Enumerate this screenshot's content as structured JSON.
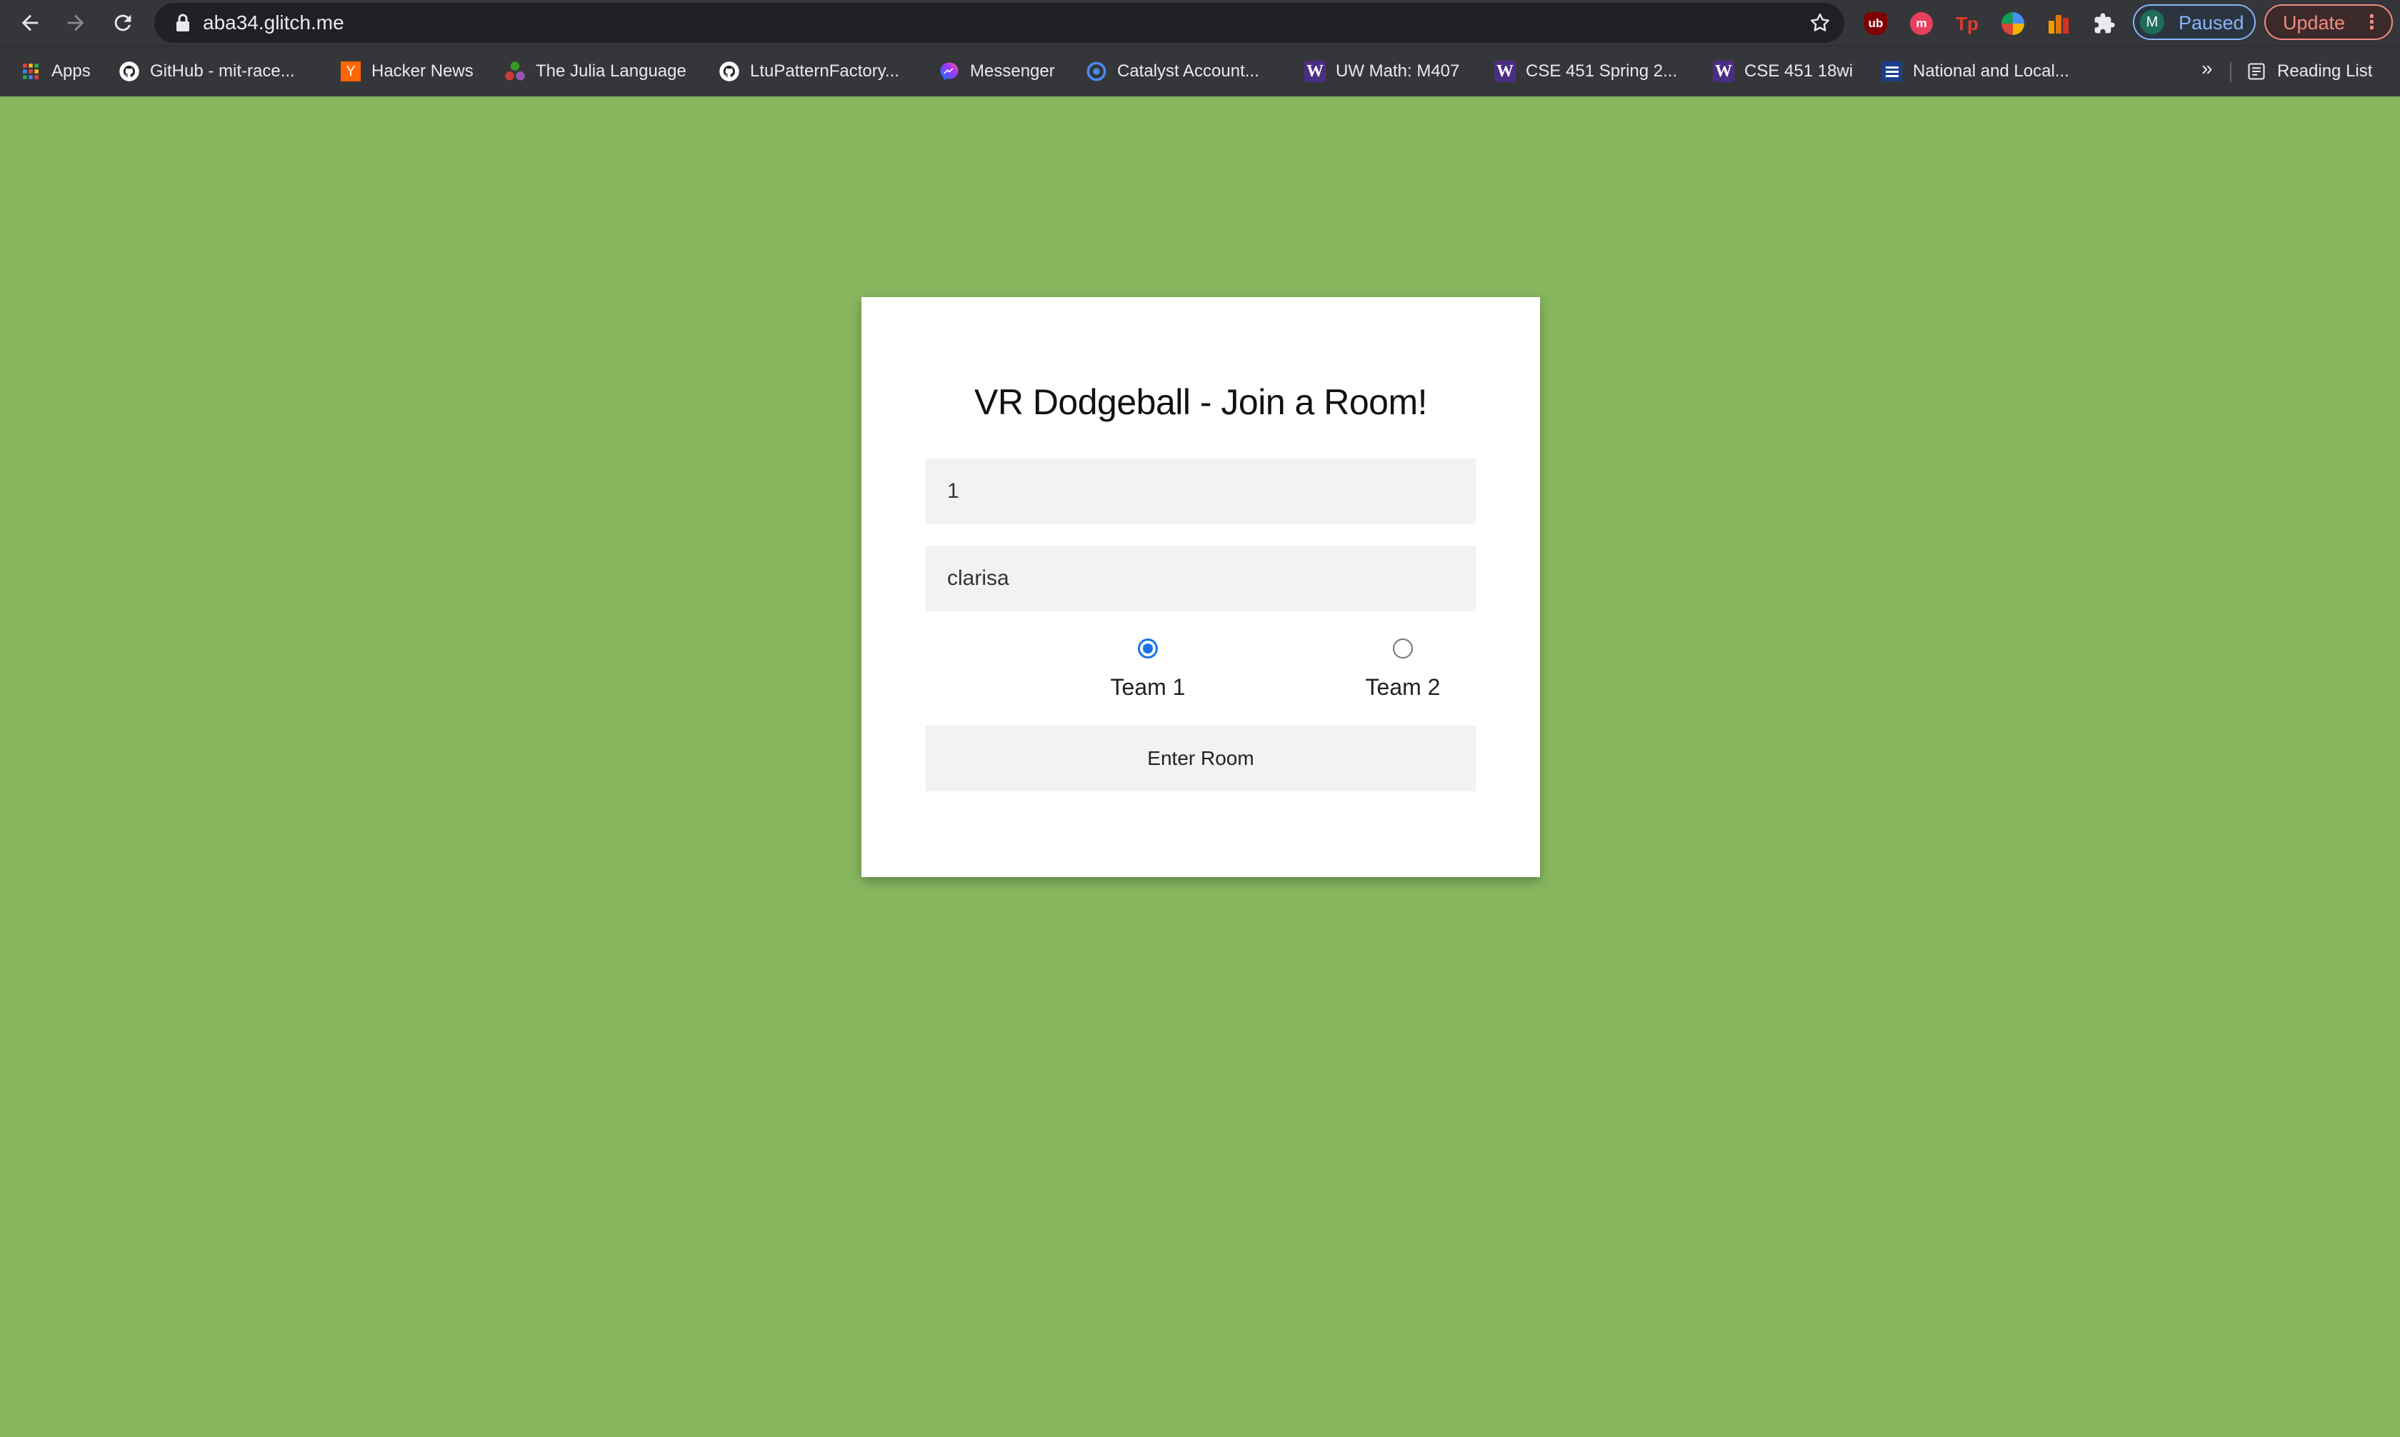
{
  "browser": {
    "url": "aba34.glitch.me",
    "profile": {
      "initial": "M",
      "label": "Paused"
    },
    "update_label": "Update",
    "extensions": [
      {
        "name": "ublock-icon",
        "text": "ub",
        "color": "#800000"
      },
      {
        "name": "mastodon-icon",
        "text": "m",
        "color": "#e5405c"
      },
      {
        "name": "tampermonkey-icon",
        "text": "Tp",
        "color": "#e33b2e"
      },
      {
        "name": "multicolor-extension-icon",
        "text": "",
        "color": "#4a8cf7"
      },
      {
        "name": "bar-chart-extension-icon",
        "text": "",
        "color": "#f29900"
      }
    ]
  },
  "bookmarks": {
    "items": [
      {
        "label": "Apps",
        "icon": "apps-grid-icon"
      },
      {
        "label": "GitHub - mit-race...",
        "icon": "github-icon"
      },
      {
        "label": "Hacker News",
        "icon": "hacker-news-icon"
      },
      {
        "label": "The Julia Language",
        "icon": "julia-icon"
      },
      {
        "label": "LtuPatternFactory...",
        "icon": "github-icon"
      },
      {
        "label": "Messenger",
        "icon": "messenger-icon"
      },
      {
        "label": "Catalyst Account...",
        "icon": "catalyst-icon"
      },
      {
        "label": "UW Math: M407",
        "icon": "uw-icon"
      },
      {
        "label": "CSE 451 Spring 2...",
        "icon": "uw-icon"
      },
      {
        "label": "CSE 451 18wi",
        "icon": "uw-icon"
      },
      {
        "label": "National and Local...",
        "icon": "news-icon"
      }
    ],
    "overflow": "»",
    "reading_list": "Reading List"
  },
  "page": {
    "title": "VR Dodgeball - Join a Room!",
    "room_value": "1",
    "name_value": "clarisa",
    "teams": [
      {
        "label": "Team 1",
        "selected": true
      },
      {
        "label": "Team 2",
        "selected": false
      }
    ],
    "enter_label": "Enter Room"
  },
  "colors": {
    "page_background": "#87b65f",
    "radio_accent": "#1a73e8"
  }
}
